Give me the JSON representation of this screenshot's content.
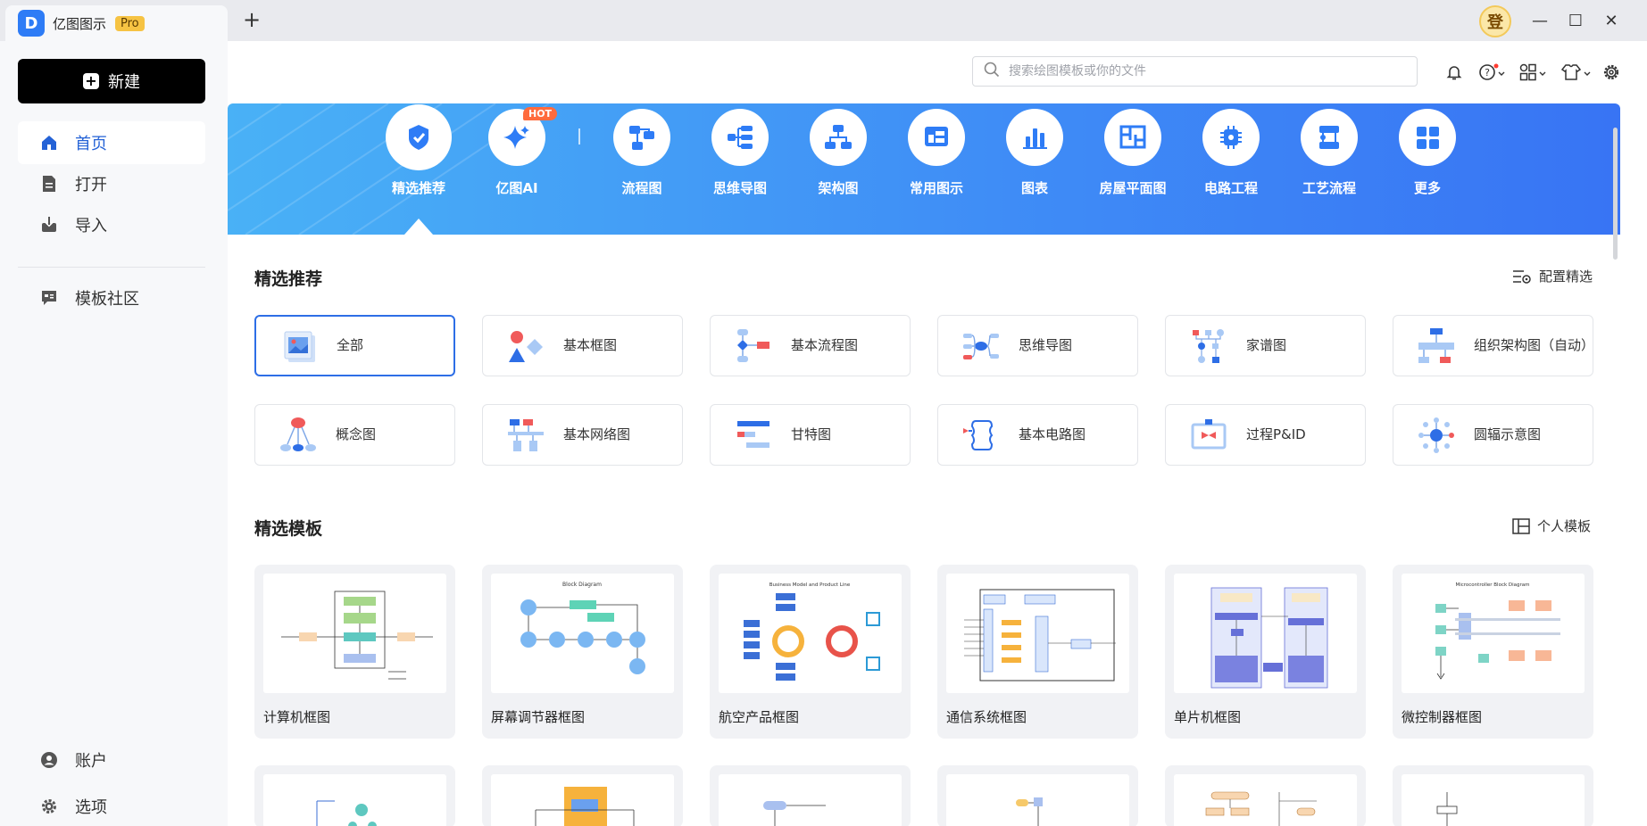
{
  "app": {
    "title": "亿图图示",
    "badge": "Pro",
    "logo_letter": "D",
    "new_tab": "+",
    "login": "登"
  },
  "window": {
    "minimize": "—",
    "maximize": "☐",
    "close": "✕"
  },
  "sidebar": {
    "new_button": "新建",
    "items": [
      {
        "label": "首页",
        "icon": "home-icon"
      },
      {
        "label": "打开",
        "icon": "document-icon"
      },
      {
        "label": "导入",
        "icon": "import-icon"
      },
      {
        "label": "模板社区",
        "icon": "community-icon"
      }
    ],
    "bottom_items": [
      {
        "label": "账户",
        "icon": "account-icon"
      },
      {
        "label": "选项",
        "icon": "gear-icon"
      }
    ]
  },
  "search": {
    "placeholder": "搜索绘图模板或你的文件"
  },
  "categories": [
    {
      "label": "精选推荐",
      "icon": "featured-icon"
    },
    {
      "label": "亿图AI",
      "icon": "ai-sparkle-icon",
      "badge": "HOT"
    },
    {
      "label": "流程图",
      "icon": "flowchart-icon"
    },
    {
      "label": "思维导图",
      "icon": "mindmap-icon"
    },
    {
      "label": "架构图",
      "icon": "org-chart-icon"
    },
    {
      "label": "常用图示",
      "icon": "diagram-icon"
    },
    {
      "label": "图表",
      "icon": "bar-chart-icon"
    },
    {
      "label": "房屋平面图",
      "icon": "floorplan-icon"
    },
    {
      "label": "电路工程",
      "icon": "circuit-icon"
    },
    {
      "label": "工艺流程",
      "icon": "process-icon"
    },
    {
      "label": "更多",
      "icon": "grid-icon"
    }
  ],
  "featured": {
    "title": "精选推荐",
    "config_link": "配置精选",
    "cards": [
      "全部",
      "基本框图",
      "基本流程图",
      "思维导图",
      "家谱图",
      "组织架构图（自动）",
      "概念图",
      "基本网络图",
      "甘特图",
      "基本电路图",
      "过程P&ID",
      "圆辐示意图"
    ]
  },
  "templates": {
    "title": "精选模板",
    "personal_link": "个人模板",
    "items": [
      "计算机框图",
      "屏幕调节器框图",
      "航空产品框图",
      "通信系统框图",
      "单片机框图",
      "微控制器框图"
    ],
    "thumb_titles": [
      "Block Diagram",
      "Business Model and Product Line",
      "Microcontroller Block Diagram"
    ]
  },
  "colors": {
    "accent": "#2d6ee6",
    "banner_start": "#49b1f6",
    "banner_end": "#3874f4",
    "hot": "#ff6b3d",
    "pro": "#f6c343"
  }
}
